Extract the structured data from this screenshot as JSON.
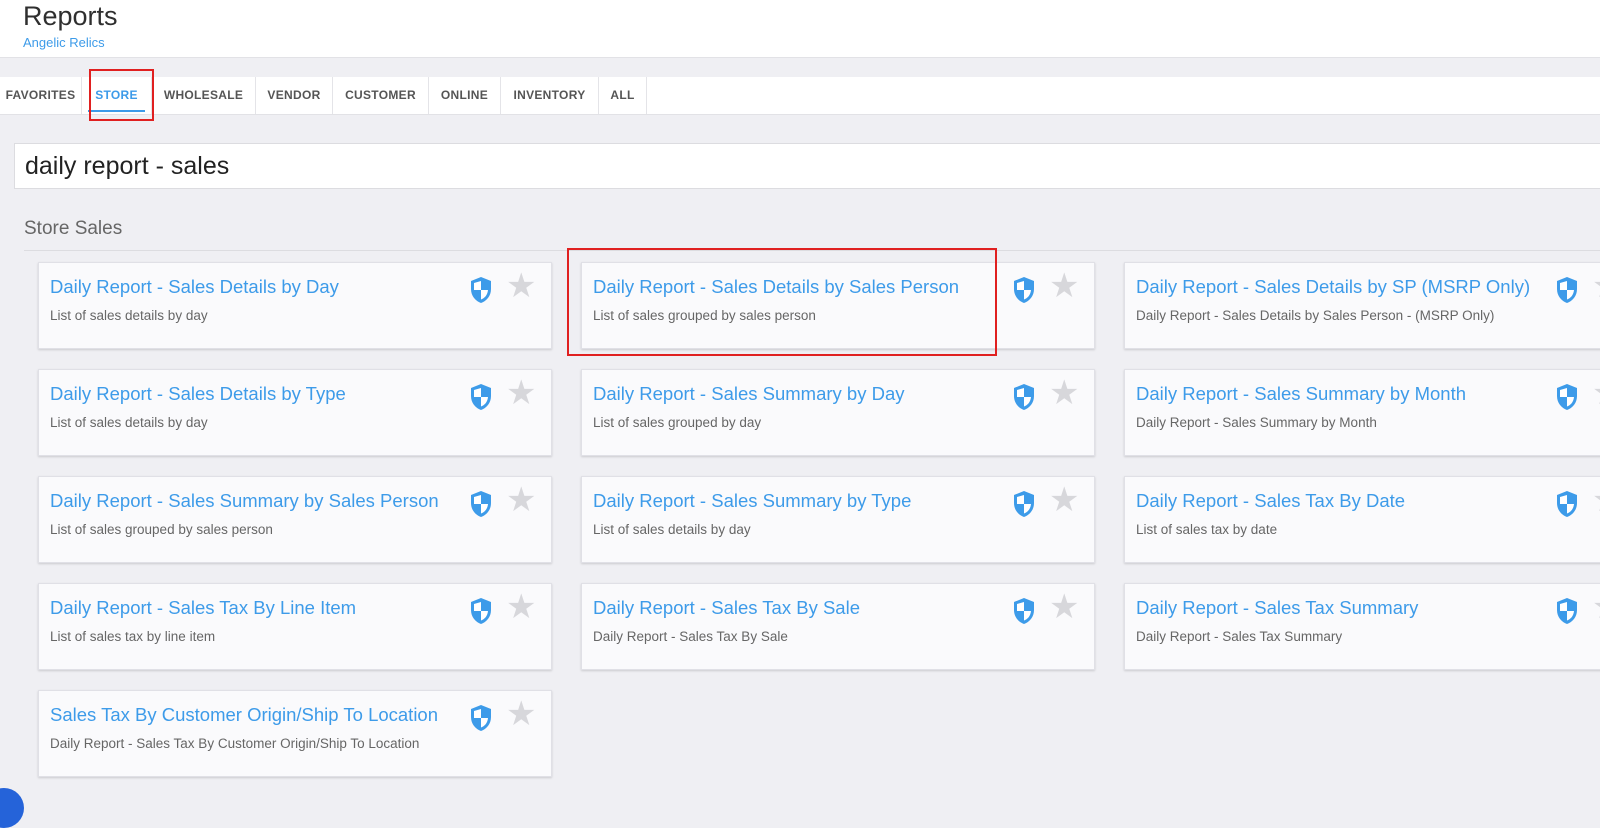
{
  "header": {
    "title": "Reports",
    "subtitle": "Angelic Relics"
  },
  "tabs": [
    {
      "label": "FAVORITES"
    },
    {
      "label": "STORE",
      "active": true
    },
    {
      "label": "WHOLESALE"
    },
    {
      "label": "VENDOR"
    },
    {
      "label": "CUSTOMER"
    },
    {
      "label": "ONLINE"
    },
    {
      "label": "INVENTORY"
    },
    {
      "label": "ALL"
    }
  ],
  "search": {
    "value": "daily report - sales"
  },
  "section": {
    "title": "Store Sales"
  },
  "colors": {
    "accent": "#3d9be9",
    "highlight": "#e02020",
    "star_inactive": "#d7d7db"
  },
  "icons": {
    "permission": "shield-icon",
    "favorite": "star-icon"
  },
  "reports": [
    {
      "title": "Daily Report - Sales Details by Day",
      "desc": "List of sales details by day"
    },
    {
      "title": "Daily Report - Sales Details by Sales Person",
      "desc": "List of sales grouped by sales person"
    },
    {
      "title": "Daily Report - Sales Details by SP (MSRP Only)",
      "desc": "Daily Report - Sales Details by Sales Person - (MSRP Only)"
    },
    {
      "title": "Daily Report - Sales Details by Type",
      "desc": "List of sales details by day"
    },
    {
      "title": "Daily Report - Sales Summary by Day",
      "desc": "List of sales grouped by day"
    },
    {
      "title": "Daily Report - Sales Summary by Month",
      "desc": "Daily Report - Sales Summary by Month"
    },
    {
      "title": "Daily Report - Sales Summary by Sales Person",
      "desc": "List of sales grouped by sales person"
    },
    {
      "title": "Daily Report - Sales Summary by Type",
      "desc": "List of sales details by day"
    },
    {
      "title": "Daily Report - Sales Tax By Date",
      "desc": "List of sales tax by date"
    },
    {
      "title": "Daily Report - Sales Tax By Line Item",
      "desc": "List of sales tax by line item"
    },
    {
      "title": "Daily Report - Sales Tax By Sale",
      "desc": "Daily Report - Sales Tax By Sale"
    },
    {
      "title": "Daily Report - Sales Tax Summary",
      "desc": "Daily Report - Sales Tax Summary"
    },
    {
      "title": "Sales Tax By Customer Origin/Ship To Location",
      "desc": "Daily Report - Sales Tax By Customer Origin/Ship To Location"
    }
  ]
}
